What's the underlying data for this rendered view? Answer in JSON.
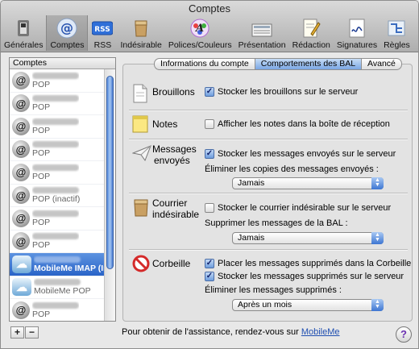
{
  "window": {
    "title": "Comptes"
  },
  "toolbar": {
    "items": [
      {
        "label": "Générales",
        "icon": "general-switch-icon",
        "selected": false
      },
      {
        "label": "Comptes",
        "icon": "at-sign-icon",
        "selected": true
      },
      {
        "label": "RSS",
        "icon": "rss-icon",
        "selected": false
      },
      {
        "label": "Indésirable",
        "icon": "junk-bag-icon",
        "selected": false
      },
      {
        "label": "Polices/Couleurs",
        "icon": "fonts-colors-icon",
        "selected": false
      },
      {
        "label": "Présentation",
        "icon": "presentation-icon",
        "selected": false
      },
      {
        "label": "Rédaction",
        "icon": "compose-pencil-icon",
        "selected": false
      },
      {
        "label": "Signatures",
        "icon": "signature-icon",
        "selected": false
      },
      {
        "label": "Règles",
        "icon": "rules-icon",
        "selected": false
      }
    ]
  },
  "sidebar": {
    "header": "Comptes",
    "accounts": [
      {
        "type": "POP",
        "icon": "at"
      },
      {
        "type": "POP",
        "icon": "at"
      },
      {
        "type": "POP",
        "icon": "at"
      },
      {
        "type": "POP",
        "icon": "at"
      },
      {
        "type": "POP",
        "icon": "at"
      },
      {
        "type": "POP (inactif)",
        "icon": "at"
      },
      {
        "type": "POP",
        "icon": "at"
      },
      {
        "type": "POP",
        "icon": "at"
      },
      {
        "type": "MobileMe IMAP (In...",
        "icon": "cloud",
        "selected": true
      },
      {
        "type": "MobileMe POP",
        "icon": "cloud"
      },
      {
        "type": "POP",
        "icon": "at"
      }
    ],
    "add_label": "+",
    "remove_label": "−"
  },
  "tabs": [
    {
      "label": "Informations du compte",
      "selected": false
    },
    {
      "label": "Comportements des BAL",
      "selected": true
    },
    {
      "label": "Avancé",
      "selected": false
    }
  ],
  "sections": {
    "drafts": {
      "label": "Brouillons",
      "checkbox": {
        "label": "Stocker les brouillons sur le serveur",
        "checked": true
      }
    },
    "notes": {
      "label": "Notes",
      "checkbox": {
        "label": "Afficher les notes dans la boîte de réception",
        "checked": false
      }
    },
    "sent": {
      "label_line1": "Messages",
      "label_line2": "envoyés",
      "checkbox": {
        "label": "Stocker les messages envoyés sur le serveur",
        "checked": true
      },
      "erase_label": "Éliminer les copies des messages envoyés :",
      "erase_value": "Jamais"
    },
    "junk": {
      "label_line1": "Courrier",
      "label_line2": "indésirable",
      "checkbox": {
        "label": "Stocker le courrier indésirable sur le serveur",
        "checked": false
      },
      "erase_label": "Supprimer les messages de la BAL :",
      "erase_value": "Jamais"
    },
    "trash": {
      "label": "Corbeille",
      "checkbox1": {
        "label": "Placer les messages supprimés dans la Corbeille",
        "checked": true
      },
      "checkbox2": {
        "label": "Stocker les messages supprimés sur le serveur",
        "checked": true
      },
      "erase_label": "Éliminer les messages supprimés :",
      "erase_value": "Après un mois"
    }
  },
  "footer": {
    "text": "Pour obtenir de l'assistance, rendez-vous sur ",
    "link": "MobileMe",
    "help": "?"
  }
}
